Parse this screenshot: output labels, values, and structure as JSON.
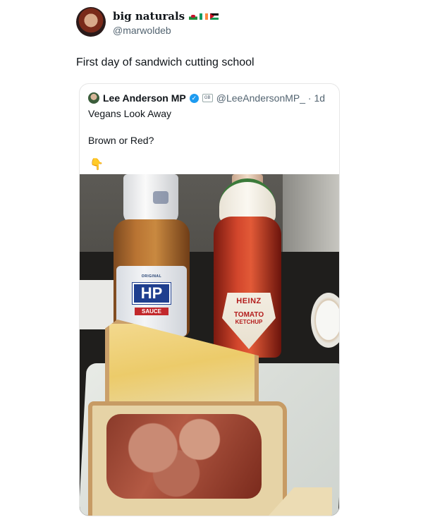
{
  "post": {
    "author_name": "big naturals",
    "flags": [
      "wales-flag",
      "ireland-flag",
      "palestine-flag"
    ],
    "handle": "@marwoldeb",
    "text": "First day of sandwich cutting school"
  },
  "quoted": {
    "author_name": "Lee Anderson MP",
    "handle_time": "@LeeAndersonMP_ · 1d",
    "line1": "Vegans Look Away",
    "line2": "Brown or Red?",
    "emoji": "👇",
    "org_badge": "GB",
    "photo": {
      "hp_original": "ORIGINAL",
      "hp_logo": "HP",
      "hp_sauce": "SAUCE",
      "heinz_brand": "HEINZ",
      "heinz_tomato": "TOMATO",
      "heinz_ketchup": "KETCHUP"
    }
  },
  "colors": {
    "verified": "#1d9bf0",
    "text": "#0f1419",
    "muted": "#536471"
  }
}
